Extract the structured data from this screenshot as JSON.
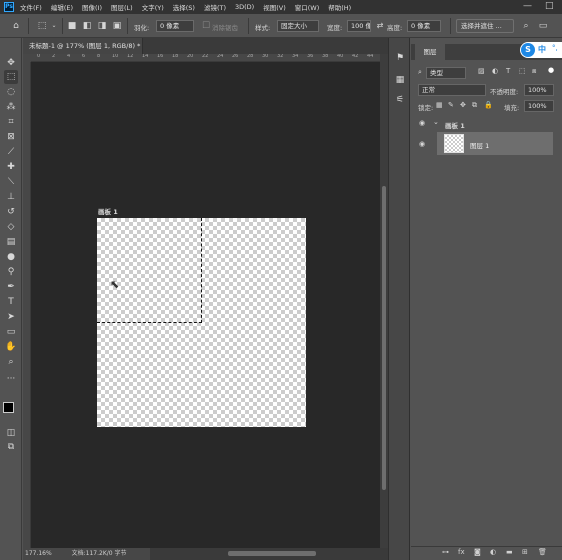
{
  "menu": [
    "文件(F)",
    "编辑(E)",
    "图像(I)",
    "图层(L)",
    "文字(Y)",
    "选择(S)",
    "滤镜(T)",
    "3D(D)",
    "视图(V)",
    "窗口(W)",
    "帮助(H)"
  ],
  "app_logo": "Ps",
  "window_controls": {
    "minimize": "—",
    "maximize": "□"
  },
  "options": {
    "feather_label": "羽化:",
    "feather_value": "0 像素",
    "antialias_label": "消除锯齿",
    "style_label": "样式:",
    "style_value": "固定大小",
    "width_label": "宽度:",
    "width_value": "100 像",
    "height_label": "高度:",
    "height_value": "0 像素",
    "select_mask_button": "选择并遮住 ..."
  },
  "document": {
    "tab_title": "未标题-1 @ 177% (图层 1, RGB/8) *",
    "tab_close": "×",
    "artboard_label": "画板 1",
    "ruler_marks": [
      "0",
      "2",
      "4",
      "6",
      "8",
      "10",
      "12",
      "14",
      "16",
      "18",
      "20",
      "22",
      "24",
      "26",
      "28",
      "30",
      "32",
      "34",
      "36",
      "38",
      "40",
      "42",
      "44",
      "46"
    ]
  },
  "statusbar": {
    "zoom": "177.16%",
    "doc_info": "文档:117.2K/0 字节"
  },
  "layers_panel": {
    "tab_label": "图层",
    "ime_logo": "S",
    "ime_text": "中",
    "ime_extra": "°,",
    "filter_kind": "类型",
    "blend_mode": "正常",
    "opacity_label": "不透明度:",
    "opacity_value": "100%",
    "lock_label": "锁定:",
    "fill_label": "填充:",
    "fill_value": "100%",
    "artboard_name": "画板 1",
    "layer_name": "图层 1"
  }
}
